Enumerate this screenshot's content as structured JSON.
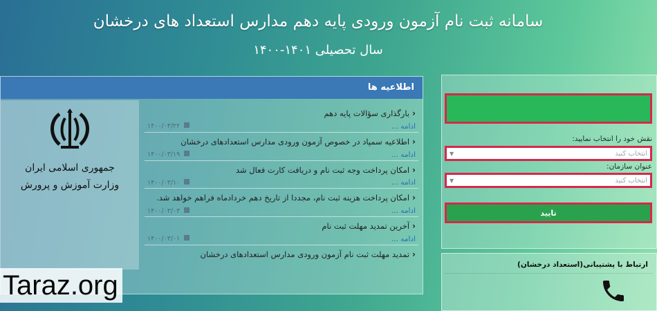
{
  "header": {
    "title": "سامانه ثبت نام آزمون ورودی پایه دهم مدارس استعداد های درخشان",
    "subtitle": "سال تحصیلی ۱۴۰۱-۱۴۰۰"
  },
  "news": {
    "heading": "اطلاعیه ها",
    "more_label": "ادامه ...",
    "items": [
      {
        "title": "بارگذاری سؤالات پایه دهم",
        "date": "۱۴۰۰/۰۳/۲۲"
      },
      {
        "title": "اطلاعیه سمپاد در خصوص آزمون ورودی مدارس استعدادهای درخشان",
        "date": "۱۴۰۰/۰۳/۱۹"
      },
      {
        "title": "امکان پرداخت وجه ثبت نام و دریافت کارت فعال شد",
        "date": "۱۴۰۰/۰۳/۱۰"
      },
      {
        "title": "امکان پرداخت هزینه ثبت نام، مجددا از تاریخ دهم خردادماه فراهم خواهد شد.",
        "date": "۱۴۰۰/۰۳/۰۳"
      },
      {
        "title": "آخرین تمدید مهلت ثبت نام",
        "date": "۱۴۰۰/۰۳/۰۱"
      },
      {
        "title": "تمدید مهلت ثبت نام آزمون ورودی مدارس استعدادهای درخشان",
        "date": ""
      }
    ]
  },
  "logo": {
    "line1": "جمهوری اسلامی ایران",
    "line2": "وزارت آموزش و پرورش"
  },
  "form": {
    "role_label": "نقش خود را انتخاب نمایید:",
    "role_placeholder": "انتخاب کنید",
    "org_label": "عنوان سازمان:",
    "org_placeholder": "انتخاب کنید",
    "submit_label": "تایید"
  },
  "support": {
    "title": "ارتباط با پشتیبانی(استعداد درخشان)"
  },
  "watermark": "Taraz.org",
  "colors": {
    "accent_blue": "#3a78b6",
    "highlight_red": "#d6284a",
    "green": "#28b859"
  }
}
